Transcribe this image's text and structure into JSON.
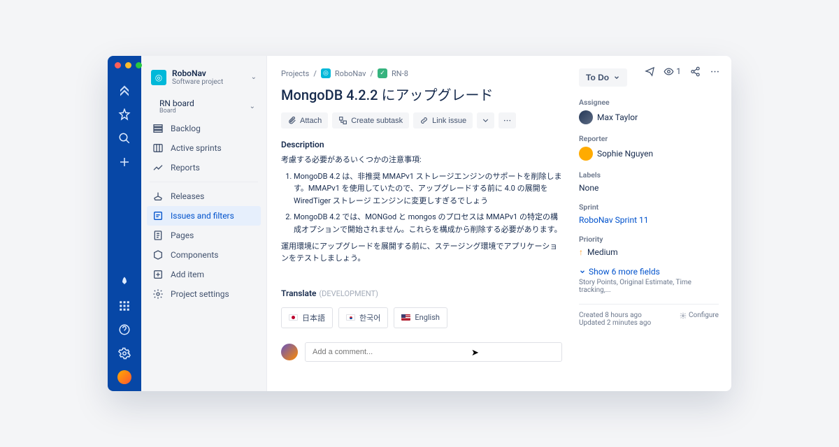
{
  "project": {
    "name": "RoboNav",
    "subtitle": "Software project"
  },
  "board": {
    "name": "RN board",
    "subtitle": "Board"
  },
  "nav": {
    "backlog": "Backlog",
    "sprints": "Active sprints",
    "reports": "Reports",
    "releases": "Releases",
    "issues": "Issues and filters",
    "pages": "Pages",
    "components": "Components",
    "add": "Add item",
    "settings": "Project settings"
  },
  "crumbs": {
    "projects": "Projects",
    "proj": "RoboNav",
    "key": "RN-8"
  },
  "issue": {
    "title": "MongoDB 4.2.2 にアップグレード",
    "desc_heading": "Description",
    "desc_intro": "考慮する必要があるいくつかの注意事項:",
    "desc_items": [
      "MongoDB 4.2 は、非推奨 MMAPv1 ストレージエンジンのサポートを削除します。MMAPv1 を使用していたので、アップグレードする前に 4.0 の展開を WiredTiger ストレージ エンジンに変更しすぎるでしょう",
      "MongoDB 4.2 では、MONGod と mongos のプロセスは MMAPv1 の特定の構成オプションで開始されません。これらを構成から削除する必要があります。"
    ],
    "desc_foot": "運用環境にアップグレードを展開する前に、ステージング環境でアプリケーションをテストしましょう。"
  },
  "actions": {
    "attach": "Attach",
    "subtask": "Create subtask",
    "link": "Link issue"
  },
  "translate": {
    "heading": "Translate",
    "dev": "(DEVELOPMENT)",
    "jp": "日本語",
    "kr": "한국어",
    "en": "English"
  },
  "comment": {
    "placeholder": "Add a comment..."
  },
  "side": {
    "status": "To Do",
    "assignee_lbl": "Assignee",
    "assignee": "Max Taylor",
    "reporter_lbl": "Reporter",
    "reporter": "Sophie Nguyen",
    "labels_lbl": "Labels",
    "labels": "None",
    "sprint_lbl": "Sprint",
    "sprint": "RoboNav Sprint 11",
    "priority_lbl": "Priority",
    "priority": "Medium",
    "more": "Show 6 more fields",
    "more_sub": "Story Points, Original Estimate, Time tracking,...",
    "created": "Created 8 hours ago",
    "updated": "Updated 2 minutes ago",
    "configure": "Configure"
  },
  "watch_count": "1"
}
